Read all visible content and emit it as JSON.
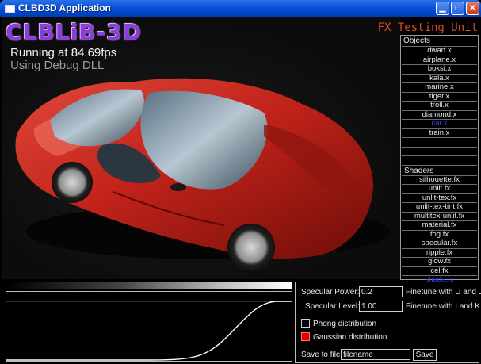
{
  "window": {
    "title": "CLBD3D Application",
    "min_glyph": "▁",
    "max_glyph": "□",
    "close_glyph": "✕"
  },
  "overlay": {
    "logo": "CLBLiB-3D",
    "fps_text": "Running at 84.69fps",
    "dll_text": "Using Debug DLL",
    "fx_label": "FX Testing Unit"
  },
  "objects": {
    "header": "Objects",
    "items": [
      "dwarf.x",
      "airplane.x",
      "boksi.x",
      "kala.x",
      "marine.x",
      "tiger.x",
      "troll.x",
      "diamond.x",
      "car.x",
      "train.x"
    ],
    "selected_index": 8
  },
  "shaders": {
    "header": "Shaders",
    "items": [
      "silhouette.fx",
      "unlit.fx",
      "unlit-tex.fx",
      "unlit-tex-tint.fx",
      "multitex-unlit.fx",
      "material.fx",
      "fog.fx",
      "specular.fx",
      "ripple.fx",
      "glow.fx",
      "cel.fx",
      "shade.fx"
    ],
    "selected_index": 11
  },
  "controls": {
    "specular_power_label": "Specular Power:",
    "specular_power_value": "0.2",
    "specular_power_hint": "Finetune with U and J.",
    "specular_level_label": "Specular Level:",
    "specular_level_value": "1.00",
    "specular_level_hint": "Finetune with I and K.",
    "phong_label": "Phong distribution",
    "phong_checked": false,
    "gaussian_label": "Gaussian distribution",
    "gaussian_checked": true,
    "save_label": "Save to file:",
    "save_value": "filename",
    "save_button": "Save"
  },
  "colors": {
    "titlebar": "#0a55d8",
    "fx_label": "#d94a22",
    "logo": "#8a3fd6",
    "car_body": "#c2231a",
    "checkbox_on": "#e00000",
    "selected_item": "#3b3bff"
  }
}
